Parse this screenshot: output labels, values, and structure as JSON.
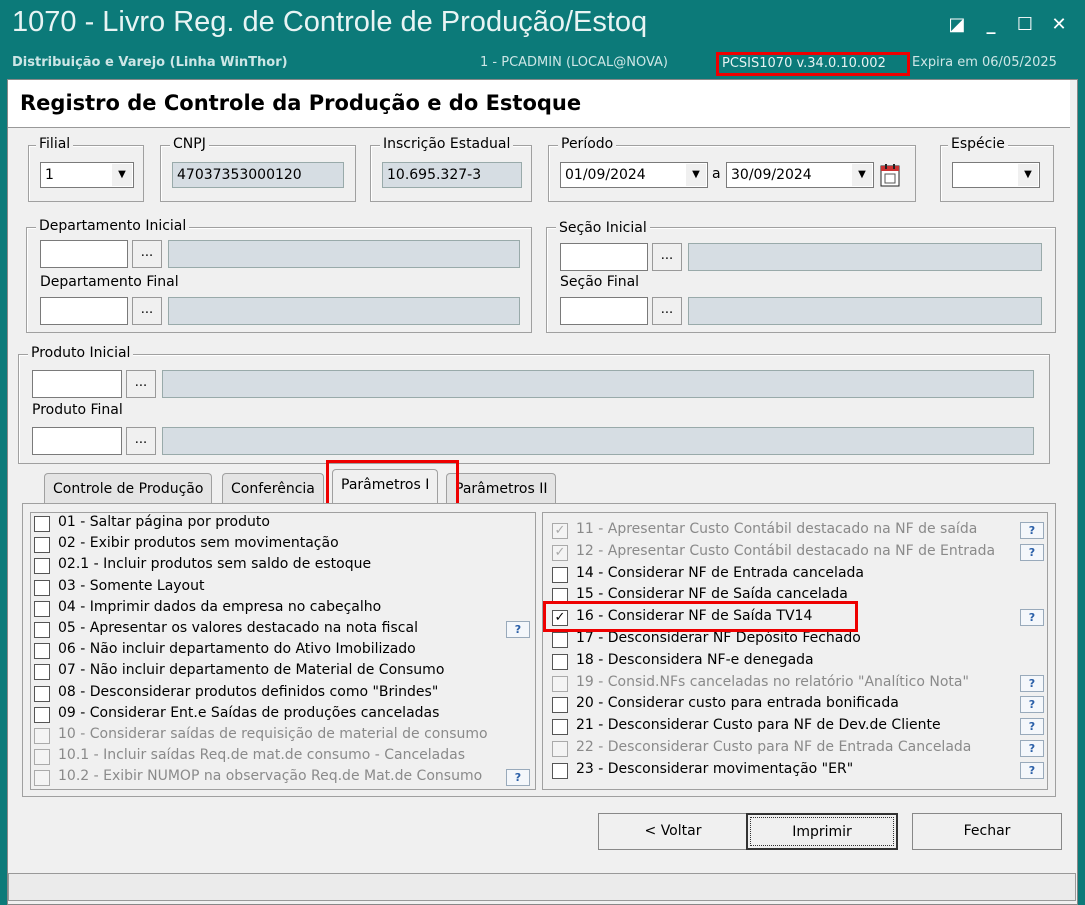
{
  "window": {
    "title": "1070 - Livro Reg. de Controle de Produção/Estoq",
    "subtitle": "Distribuição e Varejo (Linha WinThor)",
    "session": "1 - PCADMIN (LOCAL@NOVA)",
    "version": "PCSIS1070  v.34.0.10.002",
    "expires": "Expira em 06/05/2025",
    "buttons": {
      "restore": "◪",
      "minimize": "_",
      "maximize": "☐",
      "close": "✕"
    }
  },
  "page_title": "Registro de Controle da Produção e do Estoque",
  "filters": {
    "filial": {
      "label": "Filial",
      "value": "1"
    },
    "cnpj": {
      "label": "CNPJ",
      "value": "47037353000120"
    },
    "ie": {
      "label": "Inscrição Estadual",
      "value": "10.695.327-3"
    },
    "periodo": {
      "label": "Período",
      "start": "01/09/2024",
      "sep": "a",
      "end": "30/09/2024"
    },
    "especie": {
      "label": "Espécie",
      "value": ""
    },
    "dept_inicial": {
      "label": "Departamento Inicial"
    },
    "dept_final": {
      "label": "Departamento Final"
    },
    "secao_inicial": {
      "label": "Seção Inicial"
    },
    "secao_final": {
      "label": "Seção Final"
    },
    "prod_inicial": {
      "label": "Produto Inicial"
    },
    "prod_final": {
      "label": "Produto Final"
    },
    "lookup": "..."
  },
  "tabs": [
    "Controle de Produção",
    "Conferência",
    "Parâmetros I",
    "Parâmetros II"
  ],
  "left_options": [
    {
      "label": "01 - Saltar página por produto",
      "checked": false,
      "disabled": false,
      "help": false
    },
    {
      "label": "02 - Exibir produtos sem movimentação",
      "checked": false,
      "disabled": false,
      "help": false
    },
    {
      "label": "02.1 - Incluir produtos sem saldo de estoque",
      "checked": false,
      "disabled": false,
      "help": false
    },
    {
      "label": "03 - Somente Layout",
      "checked": false,
      "disabled": false,
      "help": false
    },
    {
      "label": "04 - Imprimir dados da empresa no cabeçalho",
      "checked": false,
      "disabled": false,
      "help": false
    },
    {
      "label": "05 - Apresentar os valores destacado na nota fiscal",
      "checked": false,
      "disabled": false,
      "help": true
    },
    {
      "label": "06 - Não incluir departamento do Ativo Imobilizado",
      "checked": false,
      "disabled": false,
      "help": false
    },
    {
      "label": "07 - Não incluir departamento de Material de Consumo",
      "checked": false,
      "disabled": false,
      "help": false
    },
    {
      "label": "08 - Desconsiderar produtos definidos como \"Brindes\"",
      "checked": false,
      "disabled": false,
      "help": false
    },
    {
      "label": "09 - Considerar Ent.e Saídas de produções canceladas",
      "checked": false,
      "disabled": false,
      "help": false
    },
    {
      "label": "10 - Considerar saídas de requisição de material de consumo",
      "checked": false,
      "disabled": true,
      "help": false
    },
    {
      "label": "10.1 - Incluir saídas Req.de mat.de consumo - Canceladas",
      "checked": false,
      "disabled": true,
      "help": false
    },
    {
      "label": "10.2 - Exibir NUMOP na observação Req.de Mat.de Consumo",
      "checked": false,
      "disabled": true,
      "help": true
    }
  ],
  "right_options": [
    {
      "label": "11 - Apresentar Custo Contábil destacado na NF de saída",
      "checked": true,
      "disabled": true,
      "help": true
    },
    {
      "label": "12 - Apresentar Custo Contábil destacado na NF de Entrada",
      "checked": true,
      "disabled": true,
      "help": true
    },
    {
      "label": "14 - Considerar NF de Entrada cancelada",
      "checked": false,
      "disabled": false,
      "help": false
    },
    {
      "label": "15 - Considerar NF de Saída cancelada",
      "checked": false,
      "disabled": false,
      "help": false
    },
    {
      "label": "16 - Considerar NF de Saída TV14",
      "checked": true,
      "disabled": false,
      "help": true
    },
    {
      "label": "17 - Desconsiderar NF Depósito Fechado",
      "checked": false,
      "disabled": false,
      "help": false
    },
    {
      "label": "18 - Desconsidera NF-e denegada",
      "checked": false,
      "disabled": false,
      "help": false
    },
    {
      "label": "19 - Consid.NFs canceladas no relatório \"Analítico Nota\"",
      "checked": false,
      "disabled": true,
      "help": true
    },
    {
      "label": "20 - Considerar custo para entrada bonificada",
      "checked": false,
      "disabled": false,
      "help": true
    },
    {
      "label": "21 - Desconsiderar Custo para NF de Dev.de Cliente",
      "checked": false,
      "disabled": false,
      "help": true
    },
    {
      "label": "22 - Desconsiderar Custo para NF de Entrada Cancelada",
      "checked": false,
      "disabled": true,
      "help": true
    },
    {
      "label": "23 - Desconsiderar movimentação \"ER\"",
      "checked": false,
      "disabled": false,
      "help": true
    }
  ],
  "help_label": "?",
  "check_mark": "✓",
  "buttons": {
    "back": "< Voltar",
    "print": "Imprimir",
    "close": "Fechar"
  },
  "colors": {
    "title_bar": "#0c7a79",
    "highlight": "#e00000",
    "readonly_field": "#d6dde3"
  }
}
